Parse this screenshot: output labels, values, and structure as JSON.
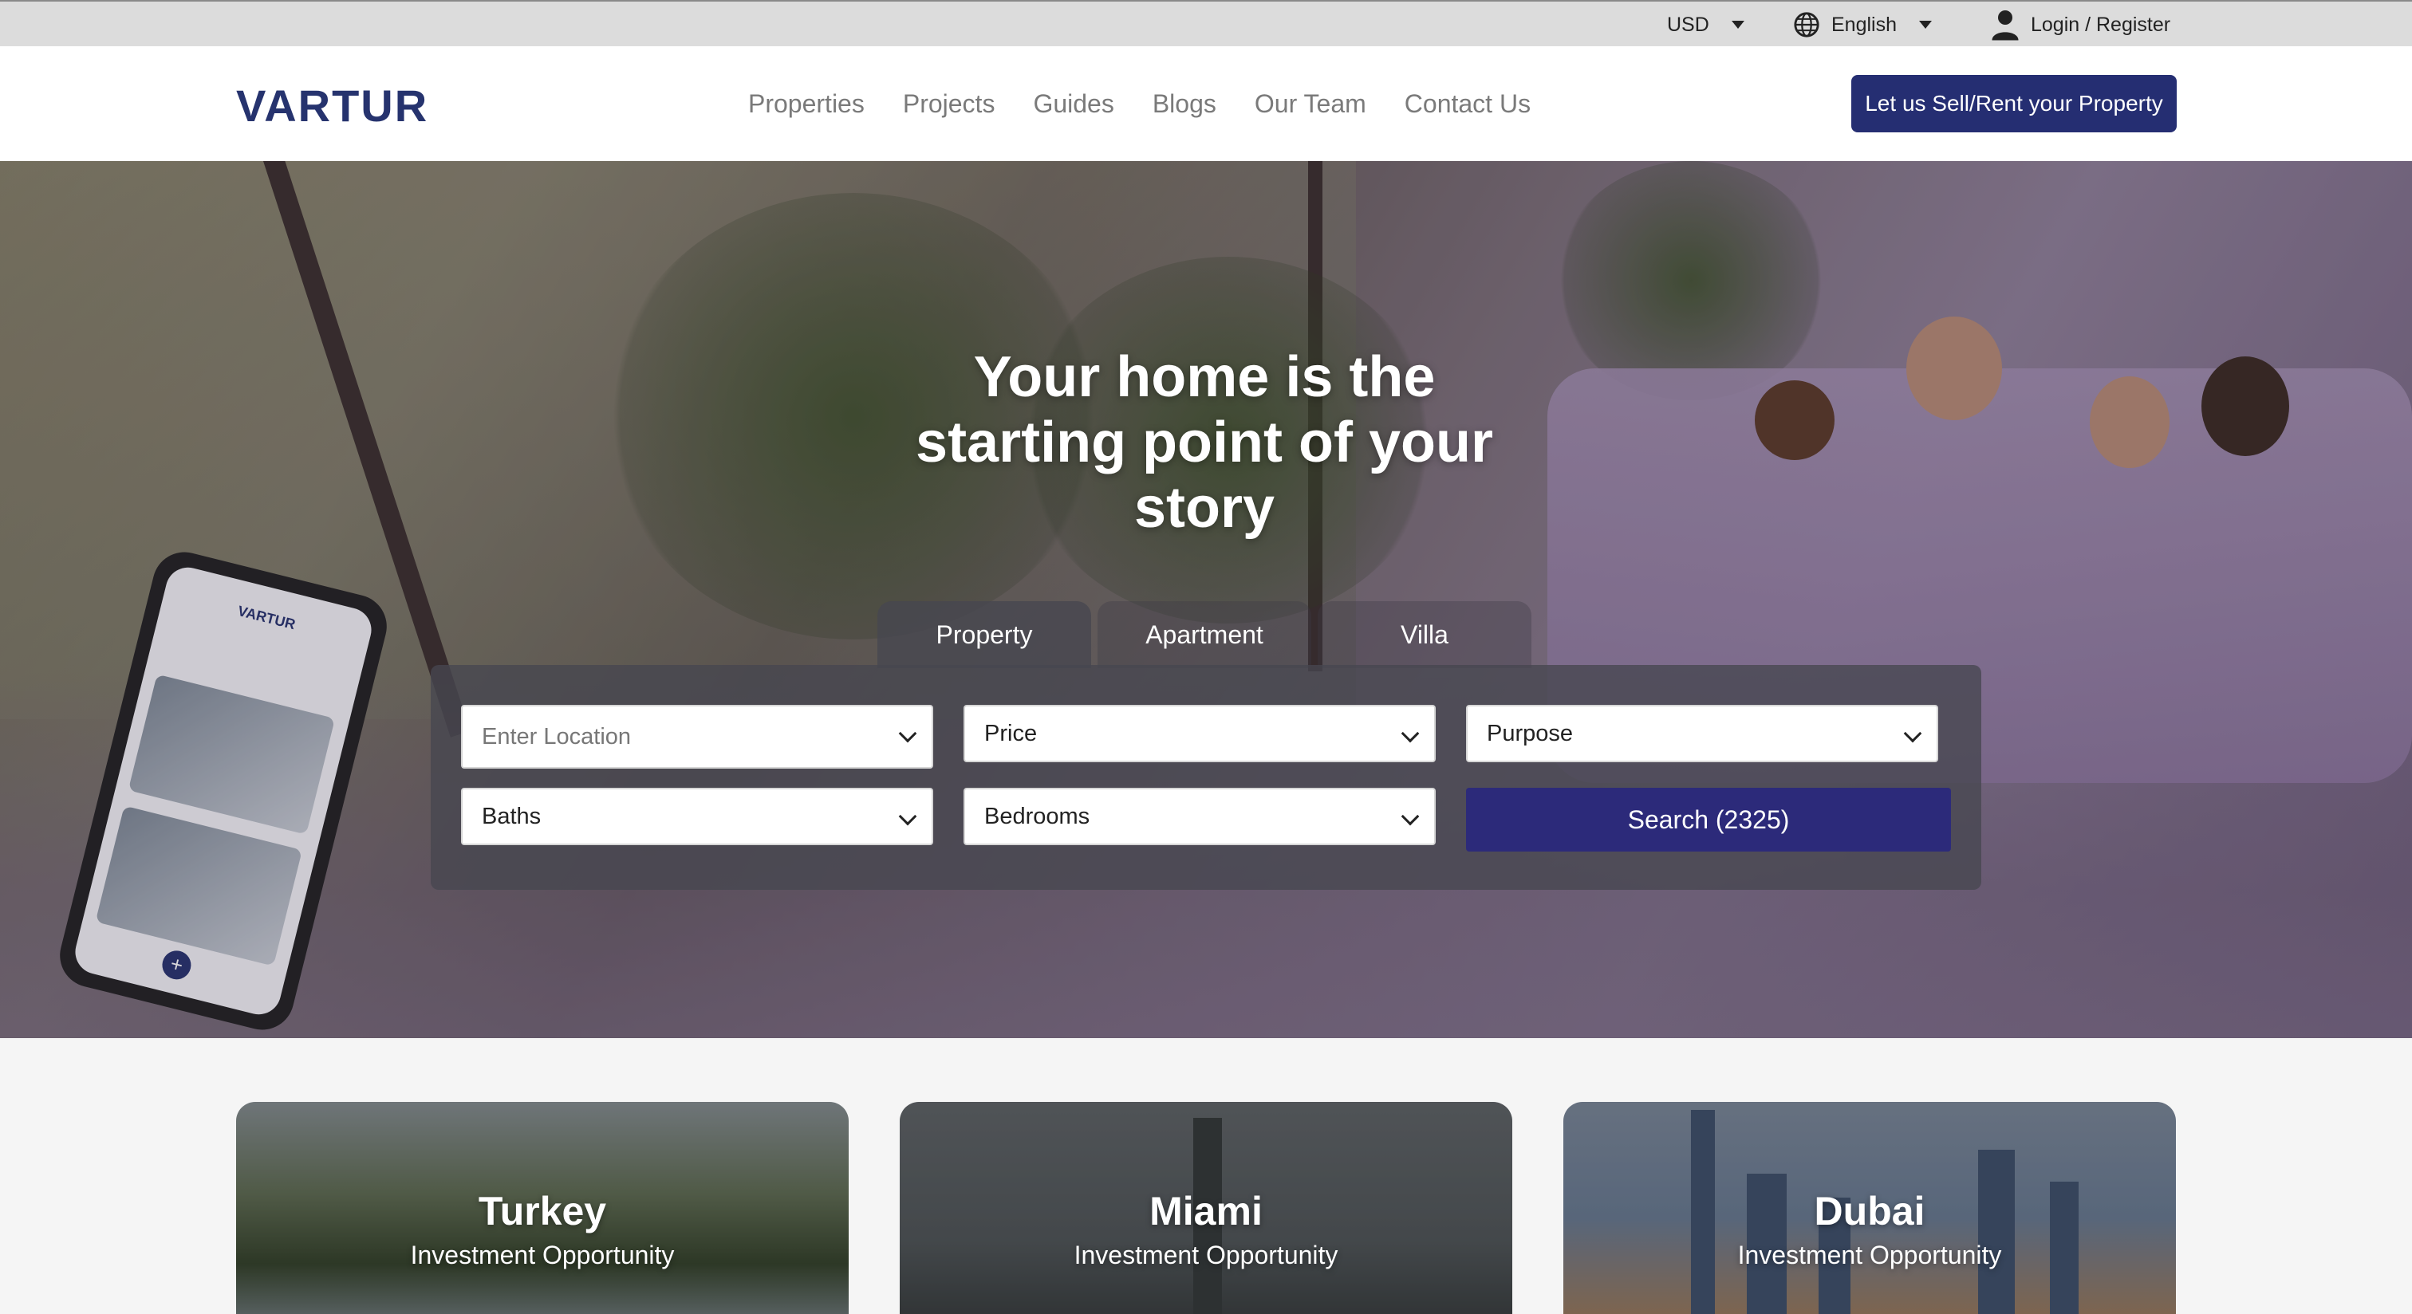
{
  "topbar": {
    "currency": "USD",
    "language": "English",
    "login": "Login / Register",
    "icons": {
      "language": "globe-icon",
      "login": "user-icon",
      "dropdown": "caret-down-icon"
    }
  },
  "header": {
    "logo": "VARTUR",
    "nav": [
      "Properties",
      "Projects",
      "Guides",
      "Blogs",
      "Our Team",
      "Contact Us"
    ],
    "cta": "Let us Sell/Rent your Property",
    "brand_color": "#26336e"
  },
  "hero": {
    "title_bold_1": "Your home",
    "title_regular_1": " is the",
    "title_regular_2": "starting point of your",
    "title_bold_2": "story",
    "phone": {
      "logo": "VARTUR"
    }
  },
  "search": {
    "tabs": [
      "Property",
      "Apartment",
      "Villa"
    ],
    "active_tab": "Property",
    "location_placeholder": "Enter Location",
    "price": "Price",
    "purpose": "Purpose",
    "baths": "Baths",
    "bedrooms": "Bedrooms",
    "button": "Search (2325)",
    "button_color": "#2c2a7a"
  },
  "destinations": [
    {
      "name": "Turkey",
      "subtitle": "Investment Opportunity"
    },
    {
      "name": "Miami",
      "subtitle": "Investment Opportunity"
    },
    {
      "name": "Dubai",
      "subtitle": "Investment Opportunity"
    }
  ]
}
